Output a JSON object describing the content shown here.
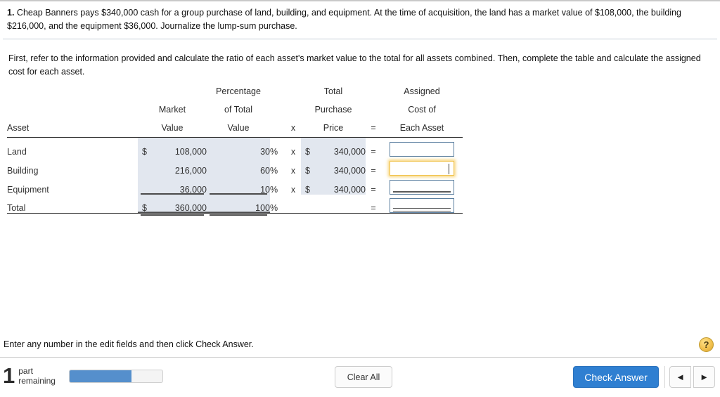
{
  "question": {
    "number": "1.",
    "text": "Cheap Banners pays $340,000 cash for a group purchase of land, building, and equipment. At the time of acquisition, the land has a market value of $108,000, the building $216,000, and the equipment $36,000. Journalize the lump-sum purchase."
  },
  "instruction": {
    "text": "First, refer to the information provided and calculate the ratio of each asset's market value to the total for all assets combined. Then, complete the table and calculate the assigned cost for each asset."
  },
  "table": {
    "headers": {
      "asset": {
        "line1": "",
        "line2": "",
        "line3": "Asset"
      },
      "market_value": {
        "line1": "",
        "line2": "Market",
        "line3": "Value"
      },
      "percentage_of_total": {
        "line1": "Percentage",
        "line2": "of Total",
        "line3": "Value"
      },
      "times_symbol": "x",
      "total_purchase_price": {
        "line1": "Total",
        "line2": "Purchase",
        "line3": "Price"
      },
      "equals_symbol": "=",
      "assigned_cost": {
        "line1": "Assigned",
        "line2": "Cost of",
        "line3": "Each Asset"
      }
    },
    "percent_symbol": "%",
    "currency_symbol": "$",
    "rows": [
      {
        "asset": "Land",
        "currency": "$",
        "market_value": "108,000",
        "percentage": "30",
        "percent_symbol": "%",
        "times": "x",
        "price_currency": "$",
        "total_price": "340,000",
        "equals": "=",
        "assigned_cost": "",
        "focused": false,
        "underline": "none"
      },
      {
        "asset": "Building",
        "currency": "",
        "market_value": "216,000",
        "percentage": "60",
        "percent_symbol": "%",
        "times": "x",
        "price_currency": "$",
        "total_price": "340,000",
        "equals": "=",
        "assigned_cost": "",
        "focused": true,
        "underline": "none"
      },
      {
        "asset": "Equipment",
        "currency": "",
        "market_value": "36,000",
        "percentage": "10",
        "percent_symbol": "%",
        "times": "x",
        "price_currency": "$",
        "total_price": "340,000",
        "equals": "=",
        "assigned_cost": "",
        "focused": false,
        "underline": "single"
      },
      {
        "asset": "Total",
        "currency": "$",
        "market_value": "360,000",
        "percentage": "100",
        "percent_symbol": "%",
        "times": "",
        "price_currency": "",
        "total_price": "",
        "equals": "=",
        "assigned_cost": "",
        "focused": false,
        "underline": "double"
      }
    ]
  },
  "footer": {
    "note": "Enter any number in the edit fields and then click Check Answer.",
    "help_label": "?",
    "parts_count": "1",
    "parts_label_line1": "part",
    "parts_label_line2": "remaining",
    "progress_percent": 67,
    "clear_all_label": "Clear All",
    "check_answer_label": "Check Answer",
    "prev_label": "◄",
    "next_label": "►"
  },
  "colors": {
    "accent_blue": "#2f7fd1",
    "progress_blue": "#558fcc",
    "shade": "#e2e7ef",
    "input_border": "#5b7fa0",
    "focus_gold": "#f0c24b",
    "help_gold": "#f2c14e"
  }
}
